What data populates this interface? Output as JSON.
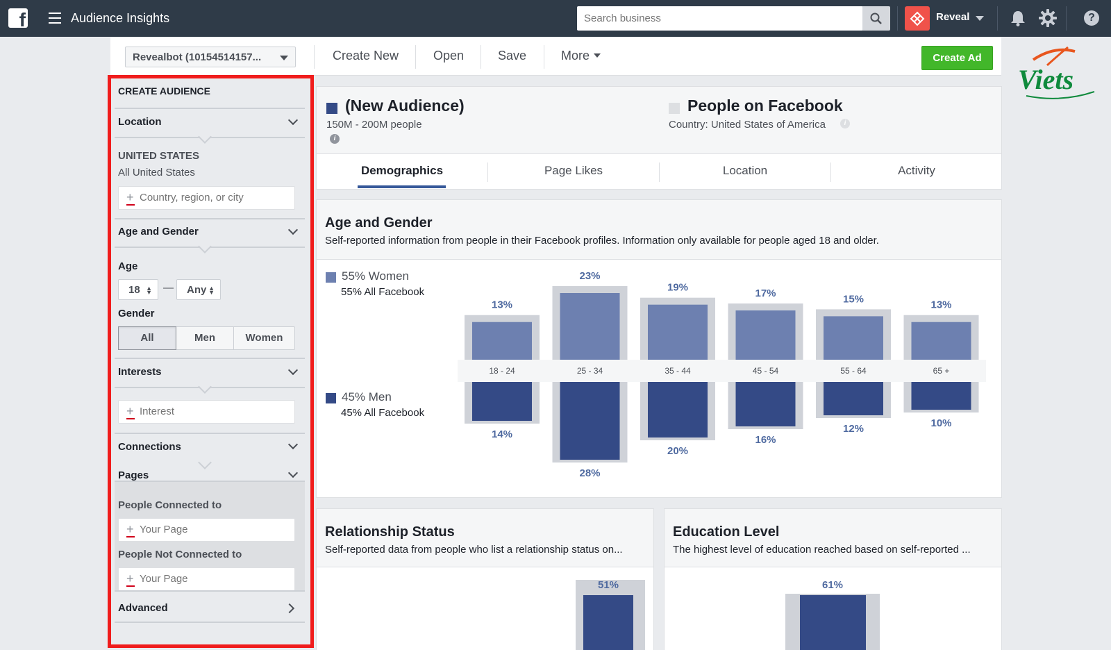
{
  "topbar": {
    "app_title": "Audience Insights",
    "search_placeholder": "Search business",
    "account_name": "Reveal",
    "help_glyph": "?"
  },
  "toolbar": {
    "account_select": "Revealbot (10154514157...",
    "create_new": "Create New",
    "open": "Open",
    "save": "Save",
    "more": "More",
    "create_ad": "Create Ad"
  },
  "sidebar": {
    "header": "CREATE AUDIENCE",
    "location": {
      "title": "Location",
      "country": "UNITED STATES",
      "country_sub": "All United States",
      "placeholder": "Country, region, or city"
    },
    "age_gender": {
      "title": "Age and Gender",
      "age_label": "Age",
      "age_min": "18",
      "age_sep": "—",
      "age_max": "Any",
      "gender_label": "Gender",
      "gender_options": [
        "All",
        "Men",
        "Women"
      ]
    },
    "interests": {
      "title": "Interests",
      "placeholder": "Interest"
    },
    "connections": {
      "title": "Connections"
    },
    "pages": {
      "title": "Pages",
      "connected_label": "People Connected to",
      "connected_placeholder": "Your Page",
      "not_connected_label": "People Not Connected to",
      "not_connected_placeholder": "Your Page"
    },
    "advanced": {
      "title": "Advanced"
    }
  },
  "audience": {
    "new_title": "(New Audience)",
    "new_size": "150M - 200M people",
    "fb_title": "People on Facebook",
    "fb_country": "Country: United States of America",
    "info_glyph": "i"
  },
  "tabs": [
    "Demographics",
    "Page Likes",
    "Location",
    "Activity"
  ],
  "age_gender_card": {
    "title": "Age and Gender",
    "description": "Self-reported information from people in their Facebook profiles. Information only available for people aged 18 and older.",
    "women_legend": "55% Women",
    "women_sub": "55% All Facebook",
    "men_legend": "45% Men",
    "men_sub": "45% All Facebook"
  },
  "relationship_card": {
    "title": "Relationship Status",
    "description": "Self-reported data from people who list a relationship status on...",
    "top_label": "51%"
  },
  "education_card": {
    "title": "Education Level",
    "description": "The highest level of education reached based on self-reported ...",
    "top_label": "61%"
  },
  "watermark": {
    "text": "Viets"
  },
  "colors": {
    "topbar": "#2f3b48",
    "women": "#6d80b0",
    "men": "#344a86",
    "facebook_bg": "#cfd2d8",
    "accent_tab": "#365899",
    "green": "#42b72a",
    "frame_red": "#f01c1c"
  },
  "chart_data": {
    "type": "bar",
    "categories": [
      "18 - 24",
      "25 - 34",
      "35 - 44",
      "45 - 54",
      "55 - 64",
      "65 +"
    ],
    "series": [
      {
        "name": "55% Women",
        "values": [
          13,
          23,
          19,
          17,
          15,
          13
        ],
        "labels": [
          "13%",
          "23%",
          "19%",
          "17%",
          "15%",
          "13%"
        ]
      },
      {
        "name": "45% Men",
        "values": [
          14,
          28,
          20,
          16,
          12,
          10
        ],
        "labels": [
          "14%",
          "28%",
          "20%",
          "16%",
          "12%",
          "10%"
        ]
      }
    ],
    "facebook_women": [
      13,
      23,
      19,
      17,
      15,
      13
    ],
    "facebook_men": [
      14,
      28,
      20,
      16,
      12,
      10
    ]
  }
}
